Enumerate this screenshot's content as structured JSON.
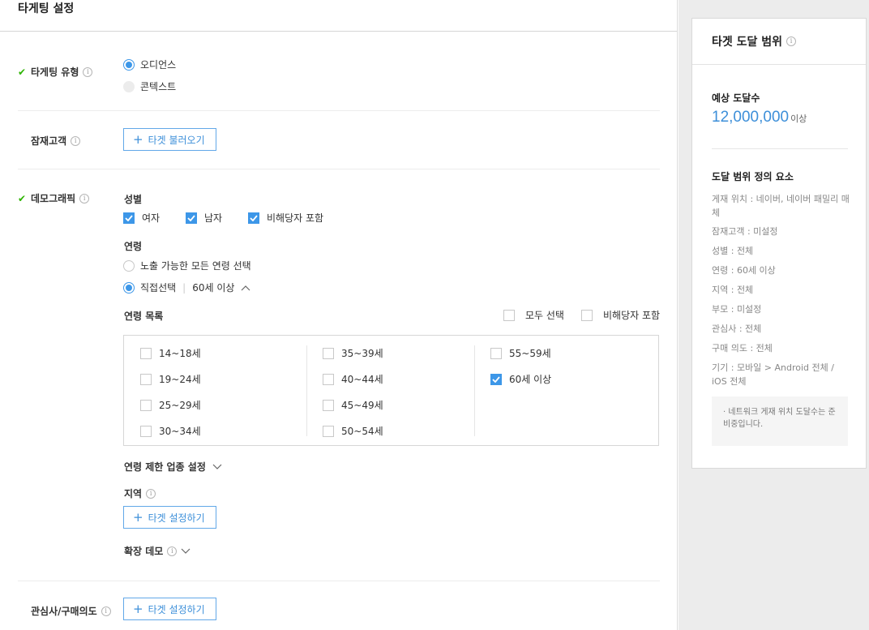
{
  "header": {
    "title": "타게팅 설정"
  },
  "targeting_type": {
    "label": "타게팅 유형",
    "options": [
      "오디언스",
      "콘텍스트"
    ],
    "selected": "오디언스"
  },
  "potential": {
    "label": "잠재고객",
    "button": "타겟 불러오기"
  },
  "demo": {
    "label": "데모그래픽",
    "gender": {
      "label": "성별",
      "options": [
        "여자",
        "남자",
        "비해당자 포함"
      ]
    },
    "age": {
      "label": "연령",
      "option_all": "노출 가능한 모든 연령 선택",
      "option_direct": "직접선택",
      "direct_summary": "60세 이상",
      "list_label": "연령 목록",
      "select_all": "모두 선택",
      "include_na": "비해당자 포함",
      "items": [
        "14~18세",
        "19~24세",
        "25~29세",
        "30~34세",
        "35~39세",
        "40~44세",
        "45~49세",
        "50~54세",
        "55~59세",
        "60세 이상"
      ],
      "checked": [
        "60세 이상"
      ]
    },
    "age_limit": "연령 제한 업종 설정",
    "region": {
      "label": "지역",
      "button": "타겟 설정하기"
    },
    "extended": "확장 데모"
  },
  "interest": {
    "label": "관심사/구매의도",
    "button": "타겟 설정하기"
  },
  "side": {
    "title": "타겟 도달 범위",
    "reach_label": "예상 도달수",
    "reach_value": "12,000,000",
    "reach_suffix": "이상",
    "factors_title": "도달 범위 정의 요소",
    "factors": [
      "게재 위치 : 네이버, 네이버 패밀리 매체",
      "잠재고객 : 미설정",
      "성별 : 전체",
      "연령 : 60세 이상",
      "지역 : 전체",
      "부모 : 미설정",
      "관심사 : 전체",
      "구매 의도 : 전체",
      "기기 : 모바일 > Android 전체 / iOS 전체"
    ],
    "note": "· 네트워크 게재 위치 도달수는 준비중입니다."
  },
  "colors": {
    "accent": "#3d97e8",
    "check": "#2db400"
  }
}
